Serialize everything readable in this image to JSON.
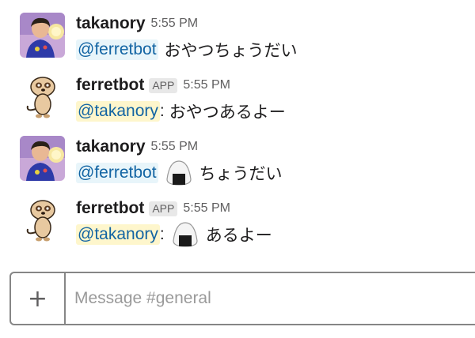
{
  "messages": [
    {
      "author": "takanory",
      "time": "5:55 PM",
      "mention": "@ferretbot",
      "text": "おやつちょうだい",
      "avatar": "takanory-avatar"
    },
    {
      "author": "ferretbot",
      "badge": "APP",
      "time": "5:55 PM",
      "mention": "@takanory",
      "separator": ":",
      "text": "おやつあるよー",
      "avatar": "ferret-avatar"
    },
    {
      "author": "takanory",
      "time": "5:55 PM",
      "mention": "@ferretbot",
      "emoji": "rice-ball-icon",
      "text": "ちょうだい",
      "avatar": "takanory-avatar"
    },
    {
      "author": "ferretbot",
      "badge": "APP",
      "time": "5:55 PM",
      "mention": "@takanory",
      "separator": ":",
      "emoji": "rice-ball-icon",
      "text": "あるよー",
      "avatar": "ferret-avatar"
    }
  ],
  "composer": {
    "plus_label": "+",
    "placeholder": "Message #general"
  },
  "colors": {
    "mention_text": "#1264a3",
    "mention_bg_blue": "#e8f5fa",
    "mention_bg_yellow": "#fef6cc",
    "border": "#868686"
  }
}
